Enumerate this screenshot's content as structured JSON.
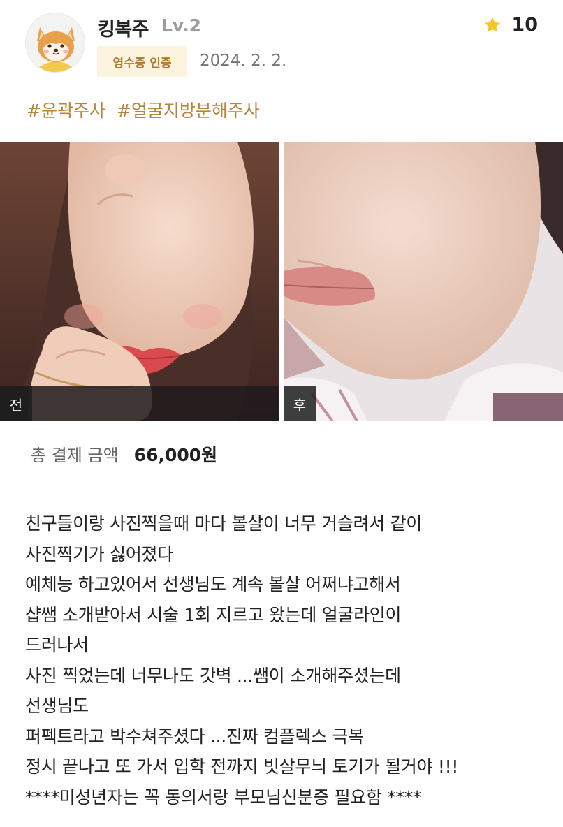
{
  "review": {
    "username": "킹복주",
    "level": "Lv.2",
    "badge": "영수증 인증",
    "date": "2024. 2. 2.",
    "rating": "10",
    "avatar_icon": "shiba-dog-avatar-icon",
    "star_icon": "star-icon",
    "star_color": "#f6c623",
    "tags": [
      "#윤곽주사",
      "#얼굴지방분해주사"
    ],
    "photos": {
      "before_label": "전",
      "after_label": "후"
    },
    "price": {
      "label": "총 결제 금액",
      "value": "66,000원"
    },
    "body_lines": [
      "친구들이랑 사진찍을때 마다 볼살이 너무 거슬려서 같이",
      "사진찍기가 싫어졌다",
      "예체능 하고있어서 선생님도 계속 볼살 어쩌냐고해서",
      "샵쌤 소개받아서 시술 1회 지르고 왔는데 얼굴라인이",
      "드러나서",
      "사진 찍었는데 너무나도 갓벽 ...쌤이 소개해주셨는데",
      "선생님도",
      "퍼펙트라고 박수쳐주셨다 ...진짜 컴플렉스 극복",
      "정시 끝나고 또 가서 입학 전까지 빗살무늬 토기가 될거야 !!!",
      "****미성년자는 꼭 동의서랑 부모님신분증 필요함 ****"
    ],
    "colors": {
      "tag": "#b5853d",
      "badge_bg": "#fbf3de",
      "badge_text": "#b07a2e"
    }
  }
}
